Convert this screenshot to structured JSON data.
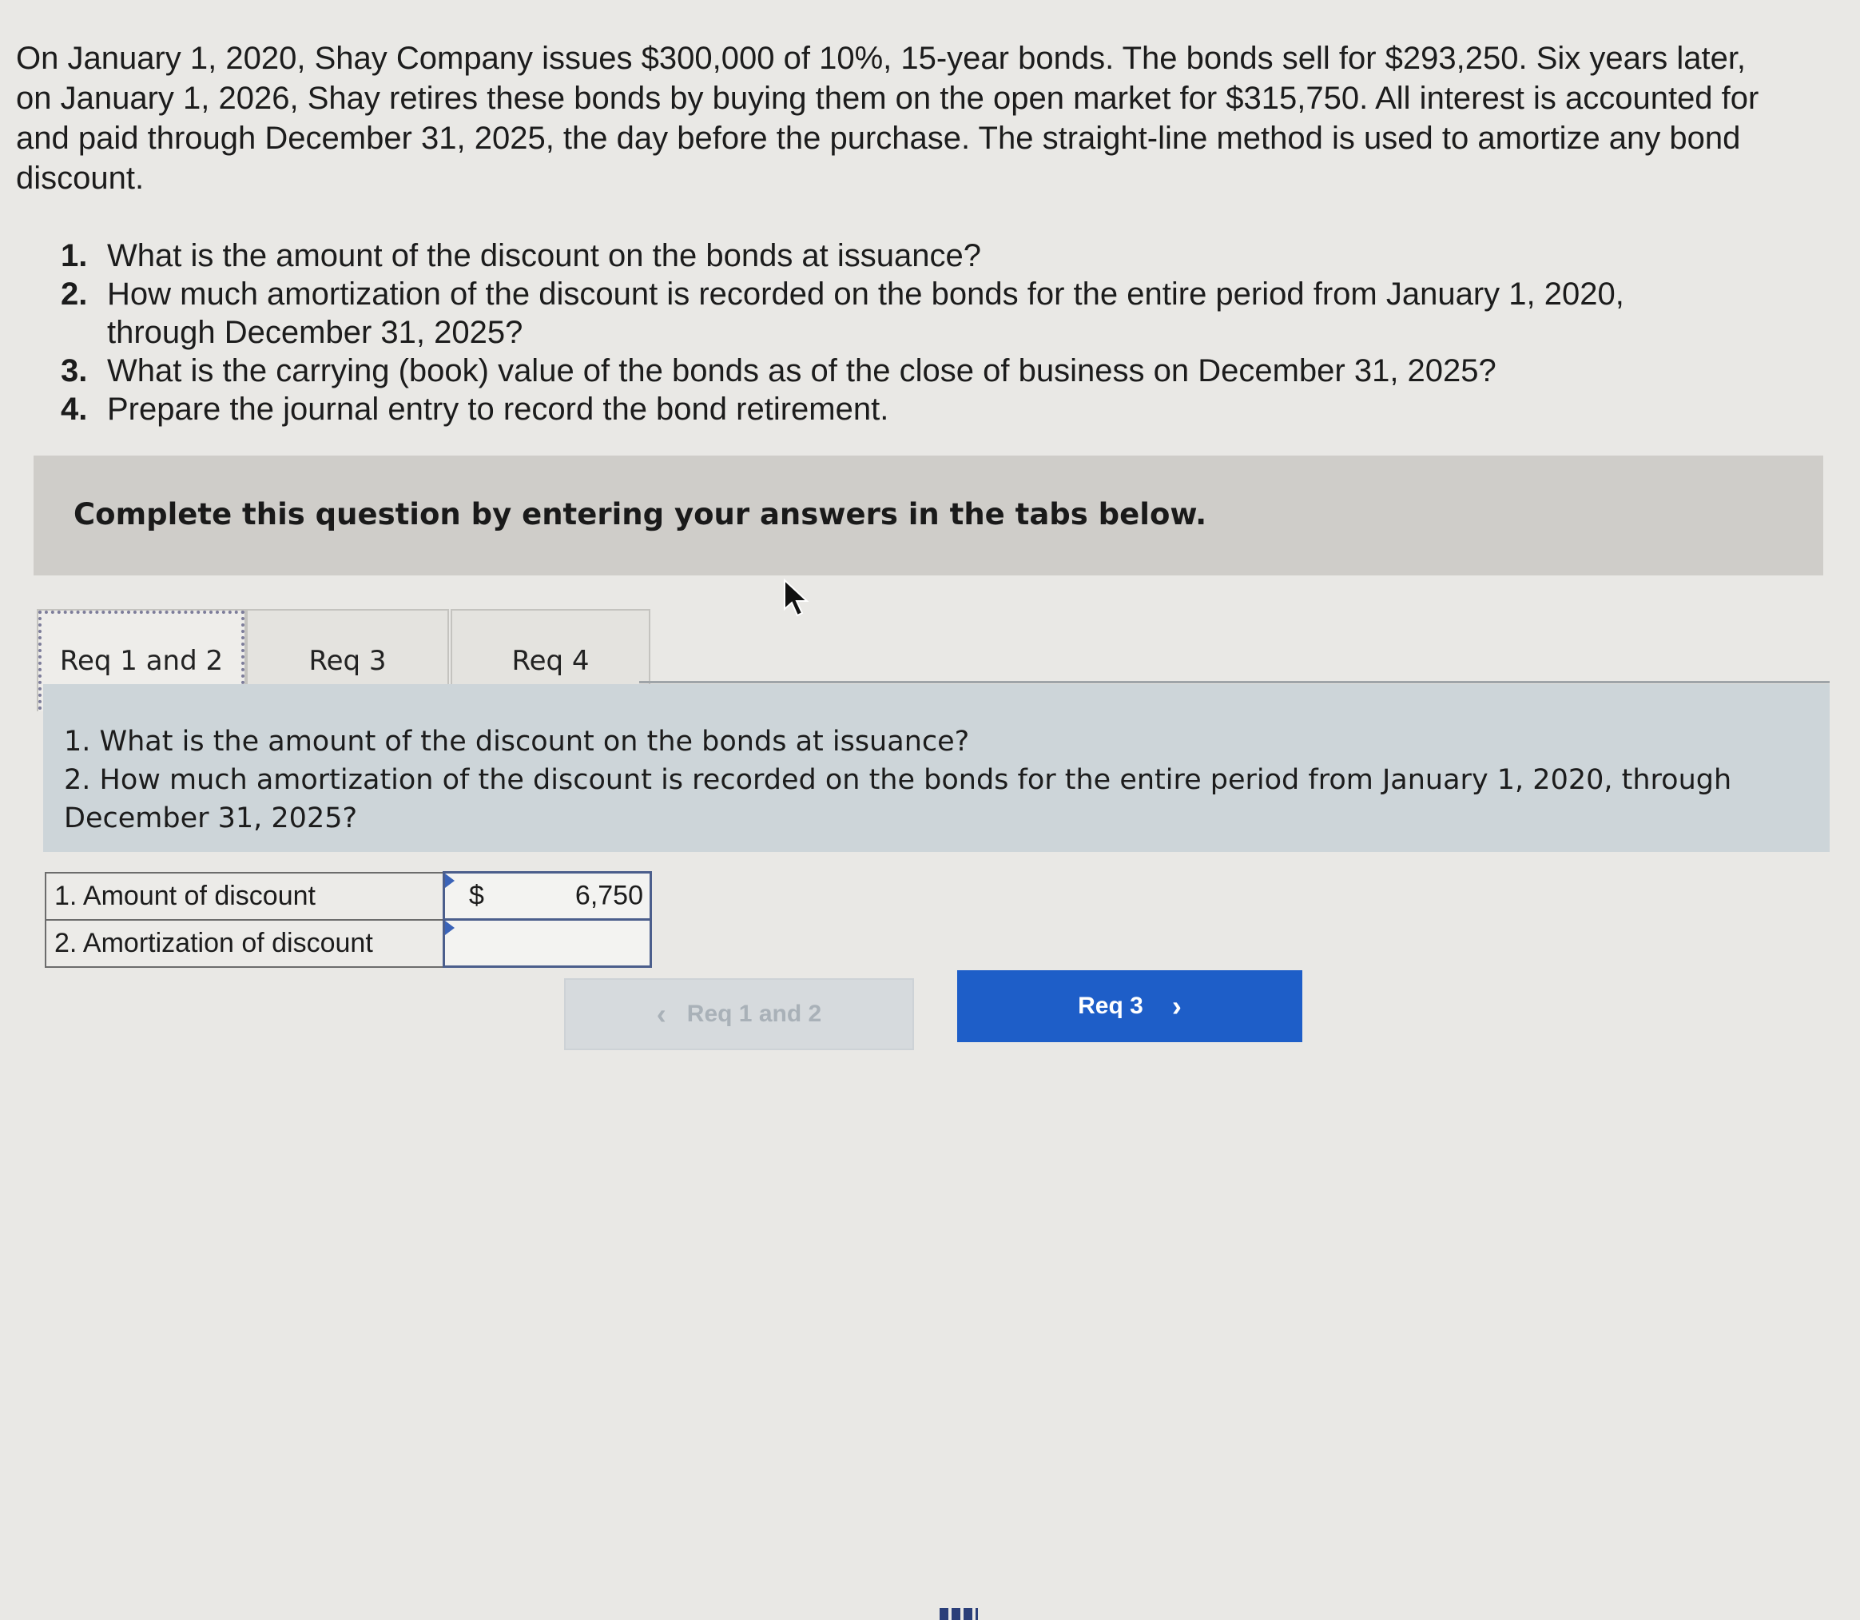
{
  "problem": {
    "statement": "On January 1, 2020, Shay Company issues $300,000 of 10%, 15-year bonds. The bonds sell for $293,250. Six years later, on January 1, 2026, Shay retires these bonds by buying them on the open market for $315,750. All interest is accounted for and paid through December 31, 2025, the day before the purchase. The straight-line method is used to amortize any bond discount.",
    "questions": [
      {
        "num": "1.",
        "text": "What is the amount of the discount on the bonds at issuance?"
      },
      {
        "num": "2.",
        "text": "How much amortization of the discount is recorded on the bonds for the entire period from January 1, 2020, through December 31, 2025?"
      },
      {
        "num": "3.",
        "text": "What is the carrying (book) value of the bonds as of the close of business on December 31, 2025?"
      },
      {
        "num": "4.",
        "text": "Prepare the journal entry to record the bond retirement."
      }
    ]
  },
  "instruction": "Complete this question by entering your answers in the tabs below.",
  "tabs": [
    {
      "label": "Req 1 and 2",
      "active": true
    },
    {
      "label": "Req 3",
      "active": false
    },
    {
      "label": "Req 4",
      "active": false
    }
  ],
  "panel": {
    "line1": "1. What is the amount of the discount on the bonds at issuance?",
    "line2": "2. How much amortization of the discount is recorded on the bonds for the entire period from January 1, 2020, through December 31, 2025?"
  },
  "answers": {
    "row1": {
      "label": "1. Amount of discount",
      "currency": "$",
      "value": "6,750"
    },
    "row2": {
      "label": "2. Amortization of discount",
      "value": ""
    }
  },
  "nav": {
    "prev_label": "Req 1 and 2",
    "next_label": "Req 3"
  },
  "colors": {
    "accent": "#1e5ec8",
    "panel": "#cdd5d9",
    "input_border": "#4b5e8c"
  },
  "icons": {
    "cursor": "mouse-pointer-icon",
    "prev": "chevron-left-icon",
    "next": "chevron-right-icon"
  }
}
